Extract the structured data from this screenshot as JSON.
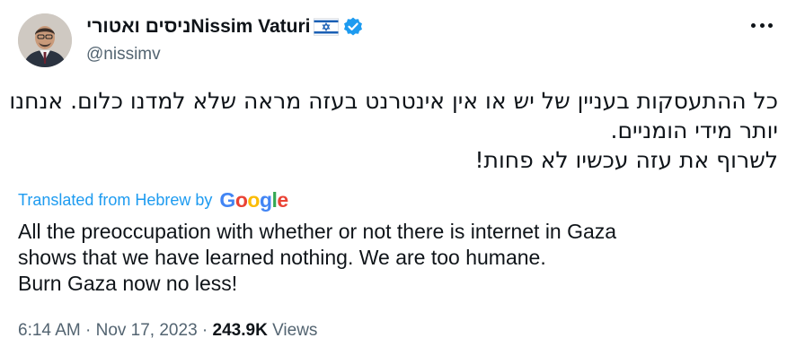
{
  "author": {
    "display_name": "ניסים ואטוריNissim Vaturi",
    "flag_icon": "israel-flag-icon",
    "verified_icon": "verified-badge-icon",
    "verified_color": "#1d9bf0",
    "handle": "@nissimv"
  },
  "tweet": {
    "hebrew_lines": [
      "כל ההתעסקות בעניין של יש או אין אינטרנט בעזה מראה שלא למדנו כלום. אנחנו",
      "יותר מידי הומניים.",
      "לשרוף את עזה עכשיו לא פחות!"
    ],
    "translated_label": "Translated from Hebrew by",
    "translation_provider": "Google",
    "translation_lines": [
      "All the preoccupation with whether or not there is internet in Gaza",
      "shows that we have learned nothing. We are too humane.",
      "Burn Gaza now no less!"
    ]
  },
  "meta": {
    "time": "6:14 AM",
    "separator": "·",
    "date": "Nov 17, 2023",
    "views_count": "243.9K",
    "views_label": "Views"
  },
  "colors": {
    "text": "#0f1419",
    "secondary": "#536471",
    "link": "#1d9bf0"
  },
  "icons": {
    "more": "more-options-icon"
  }
}
